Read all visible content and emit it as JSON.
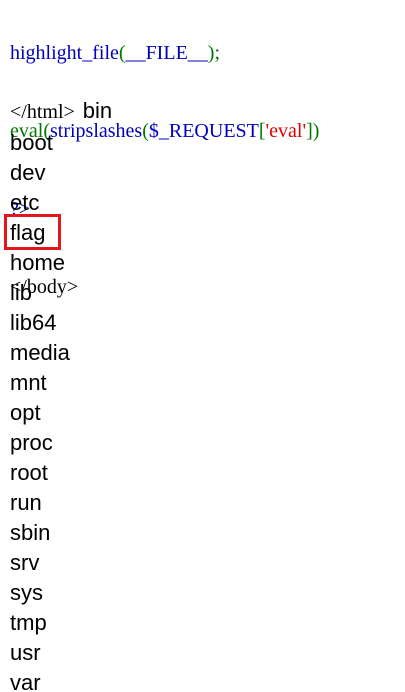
{
  "code": {
    "line1": {
      "func": "highlight_file",
      "open": "(",
      "const": "__FILE__",
      "close": ");"
    },
    "line2": {
      "func1": "eval",
      "open1": "(",
      "func2": "stripslashes",
      "open2": "(",
      "var": "$_REQUEST",
      "bracket_open": "[",
      "key": "'eval'",
      "bracket_close": "])"
    },
    "line3": "?>",
    "line4": "</body>",
    "line5_tag": "</html>"
  },
  "directory_listing": {
    "entries": [
      "bin",
      "boot",
      "dev",
      "etc",
      "flag",
      "home",
      "lib",
      "lib64",
      "media",
      "mnt",
      "opt",
      "proc",
      "root",
      "run",
      "sbin",
      "srv",
      "sys",
      "tmp",
      "usr",
      "var"
    ],
    "highlighted_entry": "flag",
    "highlight_color": "#e0181b"
  },
  "colors": {
    "php_keyword": "#0000bb",
    "php_string": "#dd0000",
    "php_punct": "#007700",
    "text": "#000000",
    "background": "#ffffff"
  }
}
